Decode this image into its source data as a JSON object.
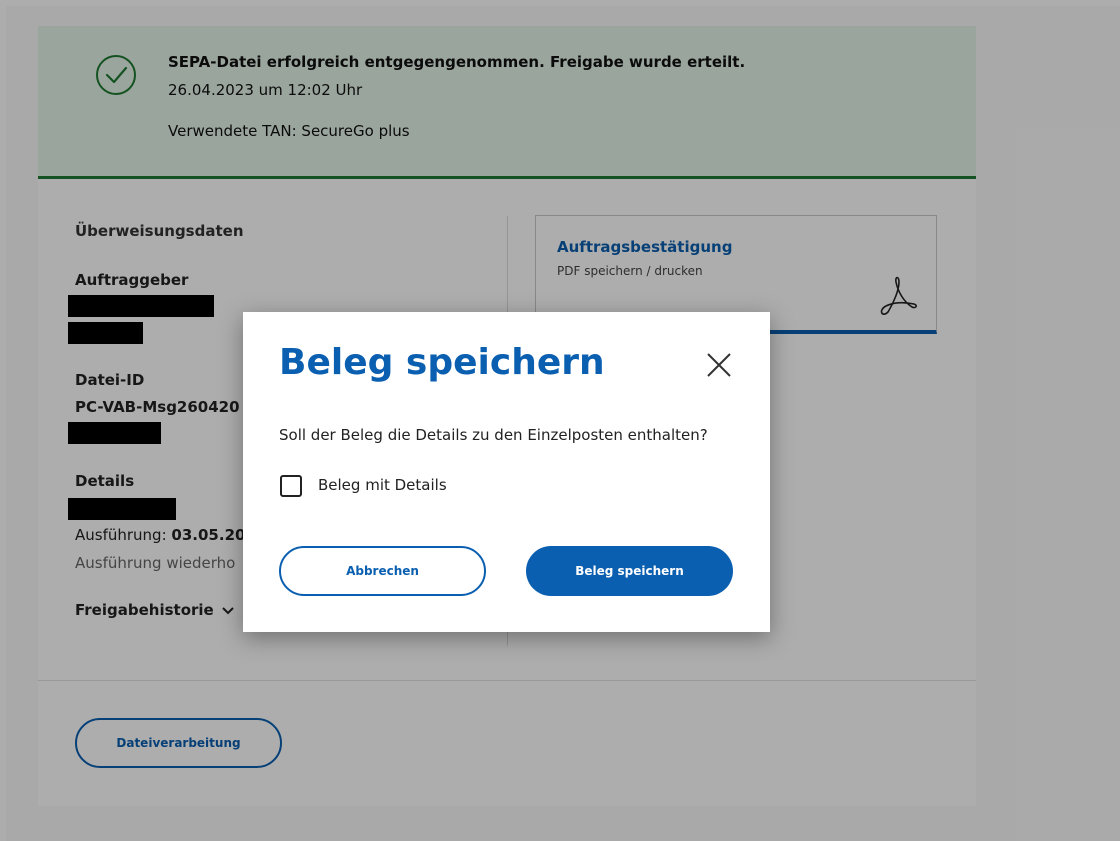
{
  "banner": {
    "title": "SEPA-Datei erfolgreich entgegengenommen. Freigabe wurde erteilt.",
    "datetime": "26.04.2023 um 12:02 Uhr",
    "tan": "Verwendete TAN: SecureGo plus",
    "icon": "check-circle-icon",
    "color": "#1f7a32"
  },
  "details": {
    "section_title": "Überweisungsdaten",
    "auftraggeber_label": "Auftraggeber",
    "datei_id_label": "Datei-ID",
    "datei_id_value": "PC-VAB-Msg260420",
    "details_label": "Details",
    "ausfuehrung_prefix": "Ausführung:",
    "ausfuehrung_date": "03.05.20",
    "wiederholung": "Ausführung wiederho",
    "freigabe": "Freigabehistorie"
  },
  "pdf_tile": {
    "title": "Auftragsbestätigung",
    "subtitle": "PDF speichern / drucken",
    "icon": "acrobat-pdf-icon"
  },
  "file_button": "Dateiverarbeitung",
  "modal": {
    "title": "Beleg speichern",
    "question": "Soll der Beleg die Details zu den Einzelposten enthalten?",
    "checkbox_label": "Beleg mit Details",
    "checkbox_checked": false,
    "cancel": "Abbrechen",
    "save": "Beleg speichern"
  },
  "colors": {
    "accent": "#0b5fb0",
    "success_bg": "#e4f3e8",
    "success_border": "#1f7a32"
  }
}
